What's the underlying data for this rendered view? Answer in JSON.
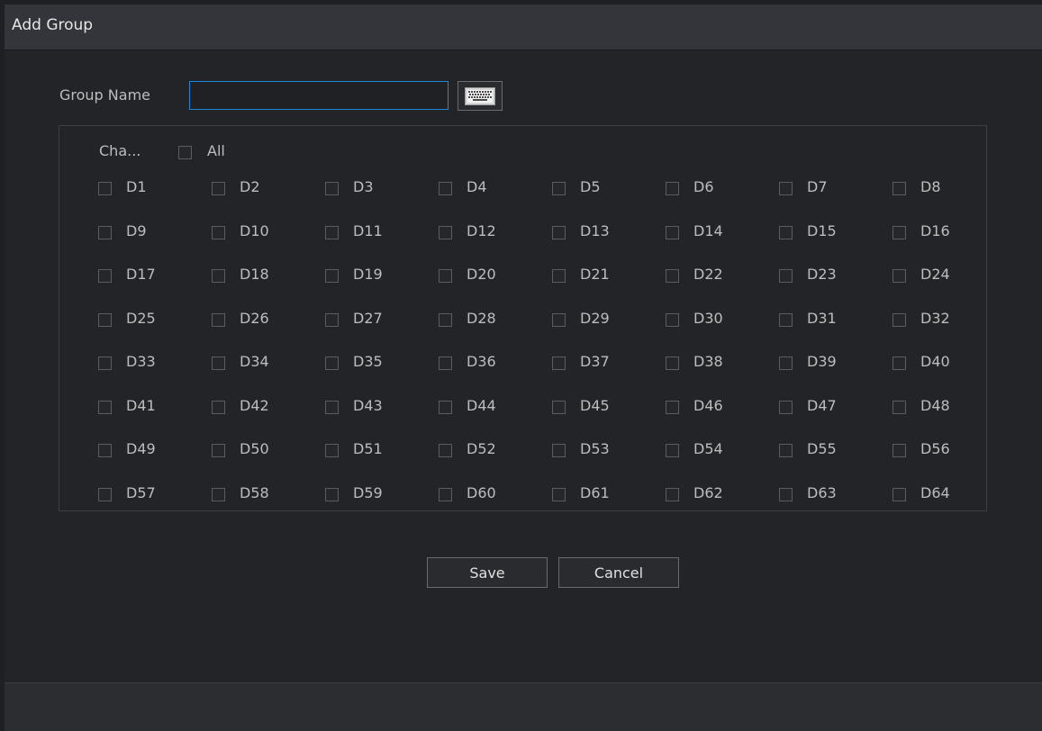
{
  "dialog": {
    "title": "Add Group"
  },
  "group_name": {
    "label": "Group Name",
    "value": "",
    "placeholder": ""
  },
  "keyboard_icon": "keyboard-icon",
  "channels": {
    "header_label": "Cha...",
    "all_label": "All",
    "all_checked": false,
    "items": [
      "D1",
      "D2",
      "D3",
      "D4",
      "D5",
      "D6",
      "D7",
      "D8",
      "D9",
      "D10",
      "D11",
      "D12",
      "D13",
      "D14",
      "D15",
      "D16",
      "D17",
      "D18",
      "D19",
      "D20",
      "D21",
      "D22",
      "D23",
      "D24",
      "D25",
      "D26",
      "D27",
      "D28",
      "D29",
      "D30",
      "D31",
      "D32",
      "D33",
      "D34",
      "D35",
      "D36",
      "D37",
      "D38",
      "D39",
      "D40",
      "D41",
      "D42",
      "D43",
      "D44",
      "D45",
      "D46",
      "D47",
      "D48",
      "D49",
      "D50",
      "D51",
      "D52",
      "D53",
      "D54",
      "D55",
      "D56",
      "D57",
      "D58",
      "D59",
      "D60",
      "D61",
      "D62",
      "D63",
      "D64"
    ]
  },
  "buttons": {
    "save_label": "Save",
    "cancel_label": "Cancel"
  },
  "colors": {
    "accent": "#1e86d6",
    "panel_bg": "#232428",
    "titlebar_bg": "#34353a"
  }
}
